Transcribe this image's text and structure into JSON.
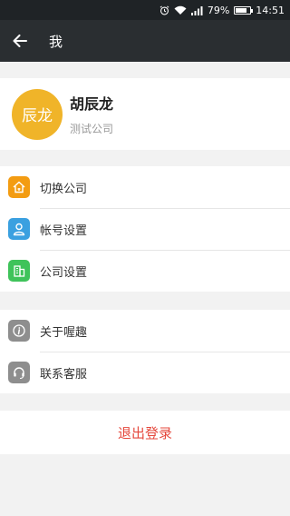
{
  "status_bar": {
    "battery": "79%",
    "time": "14:51"
  },
  "nav": {
    "title": "我"
  },
  "profile": {
    "avatar_text": "辰龙",
    "name": "胡辰龙",
    "company": "测试公司",
    "avatar_color": "#f0b429"
  },
  "menu": {
    "switch_company": {
      "label": "切换公司",
      "icon": "house-icon",
      "color": "#f39c12"
    },
    "account_settings": {
      "label": "帐号设置",
      "icon": "person-icon",
      "color": "#3aa0e0"
    },
    "company_settings": {
      "label": "公司设置",
      "icon": "building-icon",
      "color": "#3fc35a"
    },
    "about": {
      "label": "关于喔趣",
      "icon": "info-icon",
      "color": "#8e8e8e"
    },
    "support": {
      "label": "联系客服",
      "icon": "headset-icon",
      "color": "#8e8e8e"
    }
  },
  "logout": {
    "label": "退出登录",
    "color": "#e5483d"
  }
}
